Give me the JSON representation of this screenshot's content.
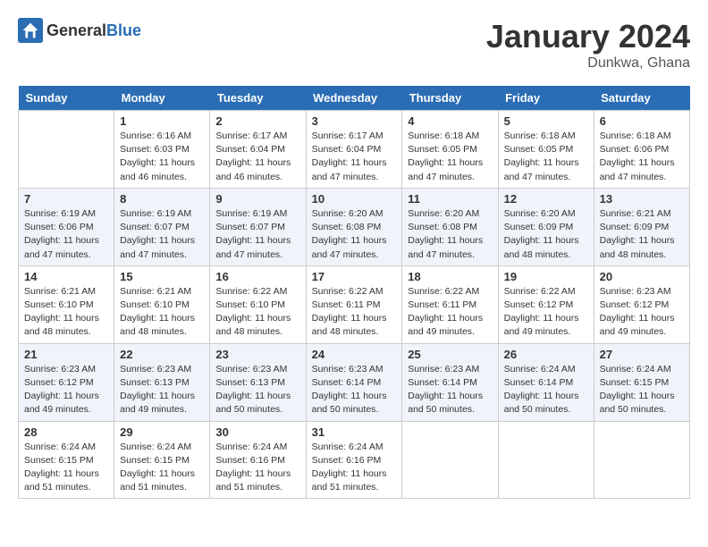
{
  "logo": {
    "text_general": "General",
    "text_blue": "Blue"
  },
  "title": "January 2024",
  "location": "Dunkwa, Ghana",
  "days": [
    "Sunday",
    "Monday",
    "Tuesday",
    "Wednesday",
    "Thursday",
    "Friday",
    "Saturday"
  ],
  "weeks": [
    [
      {
        "date": "",
        "sunrise": "",
        "sunset": "",
        "daylight": ""
      },
      {
        "date": "1",
        "sunrise": "Sunrise: 6:16 AM",
        "sunset": "Sunset: 6:03 PM",
        "daylight": "Daylight: 11 hours and 46 minutes."
      },
      {
        "date": "2",
        "sunrise": "Sunrise: 6:17 AM",
        "sunset": "Sunset: 6:04 PM",
        "daylight": "Daylight: 11 hours and 46 minutes."
      },
      {
        "date": "3",
        "sunrise": "Sunrise: 6:17 AM",
        "sunset": "Sunset: 6:04 PM",
        "daylight": "Daylight: 11 hours and 47 minutes."
      },
      {
        "date": "4",
        "sunrise": "Sunrise: 6:18 AM",
        "sunset": "Sunset: 6:05 PM",
        "daylight": "Daylight: 11 hours and 47 minutes."
      },
      {
        "date": "5",
        "sunrise": "Sunrise: 6:18 AM",
        "sunset": "Sunset: 6:05 PM",
        "daylight": "Daylight: 11 hours and 47 minutes."
      },
      {
        "date": "6",
        "sunrise": "Sunrise: 6:18 AM",
        "sunset": "Sunset: 6:06 PM",
        "daylight": "Daylight: 11 hours and 47 minutes."
      }
    ],
    [
      {
        "date": "7",
        "sunrise": "Sunrise: 6:19 AM",
        "sunset": "Sunset: 6:06 PM",
        "daylight": "Daylight: 11 hours and 47 minutes."
      },
      {
        "date": "8",
        "sunrise": "Sunrise: 6:19 AM",
        "sunset": "Sunset: 6:07 PM",
        "daylight": "Daylight: 11 hours and 47 minutes."
      },
      {
        "date": "9",
        "sunrise": "Sunrise: 6:19 AM",
        "sunset": "Sunset: 6:07 PM",
        "daylight": "Daylight: 11 hours and 47 minutes."
      },
      {
        "date": "10",
        "sunrise": "Sunrise: 6:20 AM",
        "sunset": "Sunset: 6:08 PM",
        "daylight": "Daylight: 11 hours and 47 minutes."
      },
      {
        "date": "11",
        "sunrise": "Sunrise: 6:20 AM",
        "sunset": "Sunset: 6:08 PM",
        "daylight": "Daylight: 11 hours and 47 minutes."
      },
      {
        "date": "12",
        "sunrise": "Sunrise: 6:20 AM",
        "sunset": "Sunset: 6:09 PM",
        "daylight": "Daylight: 11 hours and 48 minutes."
      },
      {
        "date": "13",
        "sunrise": "Sunrise: 6:21 AM",
        "sunset": "Sunset: 6:09 PM",
        "daylight": "Daylight: 11 hours and 48 minutes."
      }
    ],
    [
      {
        "date": "14",
        "sunrise": "Sunrise: 6:21 AM",
        "sunset": "Sunset: 6:10 PM",
        "daylight": "Daylight: 11 hours and 48 minutes."
      },
      {
        "date": "15",
        "sunrise": "Sunrise: 6:21 AM",
        "sunset": "Sunset: 6:10 PM",
        "daylight": "Daylight: 11 hours and 48 minutes."
      },
      {
        "date": "16",
        "sunrise": "Sunrise: 6:22 AM",
        "sunset": "Sunset: 6:10 PM",
        "daylight": "Daylight: 11 hours and 48 minutes."
      },
      {
        "date": "17",
        "sunrise": "Sunrise: 6:22 AM",
        "sunset": "Sunset: 6:11 PM",
        "daylight": "Daylight: 11 hours and 48 minutes."
      },
      {
        "date": "18",
        "sunrise": "Sunrise: 6:22 AM",
        "sunset": "Sunset: 6:11 PM",
        "daylight": "Daylight: 11 hours and 49 minutes."
      },
      {
        "date": "19",
        "sunrise": "Sunrise: 6:22 AM",
        "sunset": "Sunset: 6:12 PM",
        "daylight": "Daylight: 11 hours and 49 minutes."
      },
      {
        "date": "20",
        "sunrise": "Sunrise: 6:23 AM",
        "sunset": "Sunset: 6:12 PM",
        "daylight": "Daylight: 11 hours and 49 minutes."
      }
    ],
    [
      {
        "date": "21",
        "sunrise": "Sunrise: 6:23 AM",
        "sunset": "Sunset: 6:12 PM",
        "daylight": "Daylight: 11 hours and 49 minutes."
      },
      {
        "date": "22",
        "sunrise": "Sunrise: 6:23 AM",
        "sunset": "Sunset: 6:13 PM",
        "daylight": "Daylight: 11 hours and 49 minutes."
      },
      {
        "date": "23",
        "sunrise": "Sunrise: 6:23 AM",
        "sunset": "Sunset: 6:13 PM",
        "daylight": "Daylight: 11 hours and 50 minutes."
      },
      {
        "date": "24",
        "sunrise": "Sunrise: 6:23 AM",
        "sunset": "Sunset: 6:14 PM",
        "daylight": "Daylight: 11 hours and 50 minutes."
      },
      {
        "date": "25",
        "sunrise": "Sunrise: 6:23 AM",
        "sunset": "Sunset: 6:14 PM",
        "daylight": "Daylight: 11 hours and 50 minutes."
      },
      {
        "date": "26",
        "sunrise": "Sunrise: 6:24 AM",
        "sunset": "Sunset: 6:14 PM",
        "daylight": "Daylight: 11 hours and 50 minutes."
      },
      {
        "date": "27",
        "sunrise": "Sunrise: 6:24 AM",
        "sunset": "Sunset: 6:15 PM",
        "daylight": "Daylight: 11 hours and 50 minutes."
      }
    ],
    [
      {
        "date": "28",
        "sunrise": "Sunrise: 6:24 AM",
        "sunset": "Sunset: 6:15 PM",
        "daylight": "Daylight: 11 hours and 51 minutes."
      },
      {
        "date": "29",
        "sunrise": "Sunrise: 6:24 AM",
        "sunset": "Sunset: 6:15 PM",
        "daylight": "Daylight: 11 hours and 51 minutes."
      },
      {
        "date": "30",
        "sunrise": "Sunrise: 6:24 AM",
        "sunset": "Sunset: 6:16 PM",
        "daylight": "Daylight: 11 hours and 51 minutes."
      },
      {
        "date": "31",
        "sunrise": "Sunrise: 6:24 AM",
        "sunset": "Sunset: 6:16 PM",
        "daylight": "Daylight: 11 hours and 51 minutes."
      },
      {
        "date": "",
        "sunrise": "",
        "sunset": "",
        "daylight": ""
      },
      {
        "date": "",
        "sunrise": "",
        "sunset": "",
        "daylight": ""
      },
      {
        "date": "",
        "sunrise": "",
        "sunset": "",
        "daylight": ""
      }
    ]
  ]
}
